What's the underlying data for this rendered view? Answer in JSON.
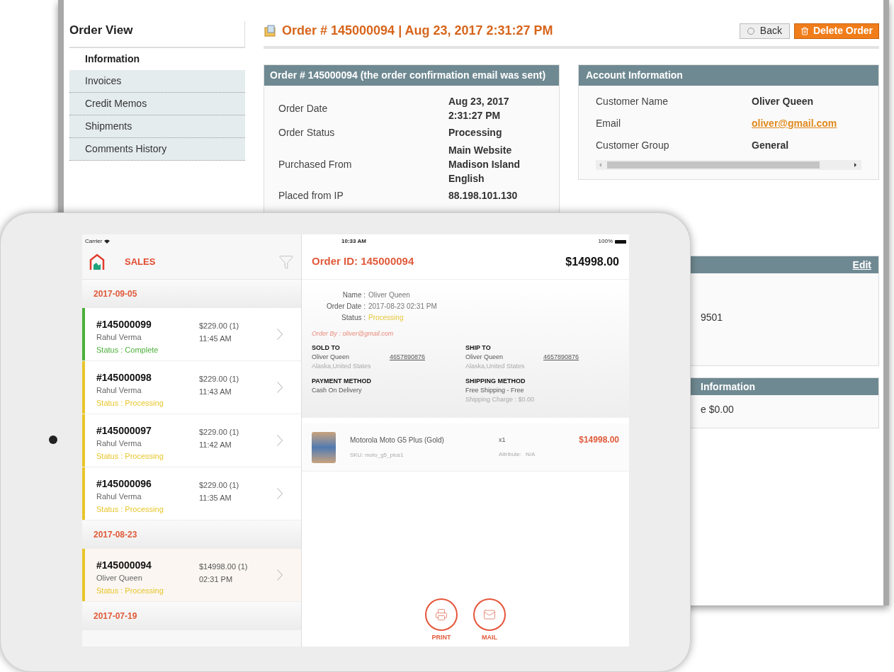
{
  "admin": {
    "sidebar": {
      "title": "Order View",
      "tabs": [
        {
          "label": "Information",
          "selected": true
        },
        {
          "label": "Invoices",
          "selected": false
        },
        {
          "label": "Credit Memos",
          "selected": false
        },
        {
          "label": "Shipments",
          "selected": false
        },
        {
          "label": "Comments History",
          "selected": false
        }
      ]
    },
    "page_title": "Order # 145000094 | Aug 23, 2017 2:31:27 PM",
    "buttons": [
      {
        "label": "Back",
        "kind": "back"
      },
      {
        "label": "Delete Order",
        "kind": "delete"
      }
    ],
    "order_box": {
      "title": "Order # 145000094",
      "title_note": "(the order confirmation email was sent)",
      "rows": [
        {
          "label": "Order Date",
          "value": [
            "Aug 23, 2017",
            "2:31:27 PM"
          ]
        },
        {
          "label": "Order Status",
          "value": [
            "Processing"
          ]
        },
        {
          "label": "Purchased From",
          "value": [
            "Main Website",
            "Madison Island",
            "English"
          ]
        },
        {
          "label": "Placed from IP",
          "value": [
            "88.198.101.130"
          ]
        }
      ]
    },
    "account_box": {
      "title": "Account Information",
      "rows": [
        {
          "label": "Customer Name",
          "value": "Oliver Queen",
          "kind": "text"
        },
        {
          "label": "Email",
          "value": "oliver@gmail.com",
          "kind": "link"
        },
        {
          "label": "Customer Group",
          "value": "General",
          "kind": "text"
        }
      ]
    },
    "address_box": {
      "action": "Edit",
      "text": "9501"
    },
    "shipping_box": {
      "title": "Information",
      "text": "e $0.00"
    }
  },
  "tablet": {
    "status_bar": {
      "carrier": "Carrier",
      "time": "10:33 AM",
      "battery": "100%"
    },
    "app_title": "SALES",
    "groups": [
      {
        "date": "2017-09-05",
        "orders": [
          {
            "id": "#145000099",
            "customer": "Rahul Verma",
            "amount": "$229.00 (1)",
            "time": "11:45 AM",
            "status": "Status : Complete",
            "color": "#4caf3a",
            "selected": false
          },
          {
            "id": "#145000098",
            "customer": "Rahul Verma",
            "amount": "$229.00 (1)",
            "time": "11:43 AM",
            "status": "Status : Processing",
            "color": "#e8c52a",
            "selected": false
          },
          {
            "id": "#145000097",
            "customer": "Rahul Verma",
            "amount": "$229.00 (1)",
            "time": "11:42 AM",
            "status": "Status : Processing",
            "color": "#e8c52a",
            "selected": false
          },
          {
            "id": "#145000096",
            "customer": "Rahul Verma",
            "amount": "$229.00 (1)",
            "time": "11:35 AM",
            "status": "Status : Processing",
            "color": "#e8c52a",
            "selected": false
          }
        ]
      },
      {
        "date": "2017-08-23",
        "orders": [
          {
            "id": "#145000094",
            "customer": "Oliver Queen",
            "amount": "$14998.00 (1)",
            "time": "02:31 PM",
            "status": "Status : Processing",
            "color": "#e8c52a",
            "selected": true
          }
        ]
      },
      {
        "date": "2017-07-19"
      }
    ],
    "detail": {
      "order_id": "Order ID: 145000094",
      "total": "$14998.00",
      "info": [
        {
          "label": "Name :",
          "value": "Oliver Queen",
          "kind": "plain"
        },
        {
          "label": "Order Date :",
          "value": "2017-08-23 02:31 PM",
          "kind": "plain"
        },
        {
          "label": "Status :",
          "value": "Processing",
          "kind": "status"
        }
      ],
      "order_by": "Order By : oliver@gmail.com",
      "sections": [
        {
          "title": "SOLD TO",
          "name": "Oliver Queen",
          "phone": "4657890876",
          "lines": [
            "Alaska,United States"
          ]
        },
        {
          "title": "SHIP TO",
          "name": "Oliver Queen",
          "phone": "4657890876",
          "lines": [
            "Alaska,United States"
          ]
        },
        {
          "title": "PAYMENT METHOD",
          "name": "Cash On Delivery"
        },
        {
          "title": "SHIPPING METHOD",
          "name": "Free Shipping - Free",
          "lines": [
            "Shipping Charge : $0.00"
          ]
        }
      ],
      "item": {
        "name": "Motorola Moto G5 Plus (Gold)",
        "sku": "SKU: moto_g5_plus1",
        "qty": "x1",
        "attribute_label": "Attribute:",
        "attribute_value": "N/A",
        "price": "$14998.00"
      },
      "actions": [
        {
          "label": "PRINT",
          "kind": "print"
        },
        {
          "label": "MAIL",
          "kind": "mail"
        }
      ]
    }
  }
}
